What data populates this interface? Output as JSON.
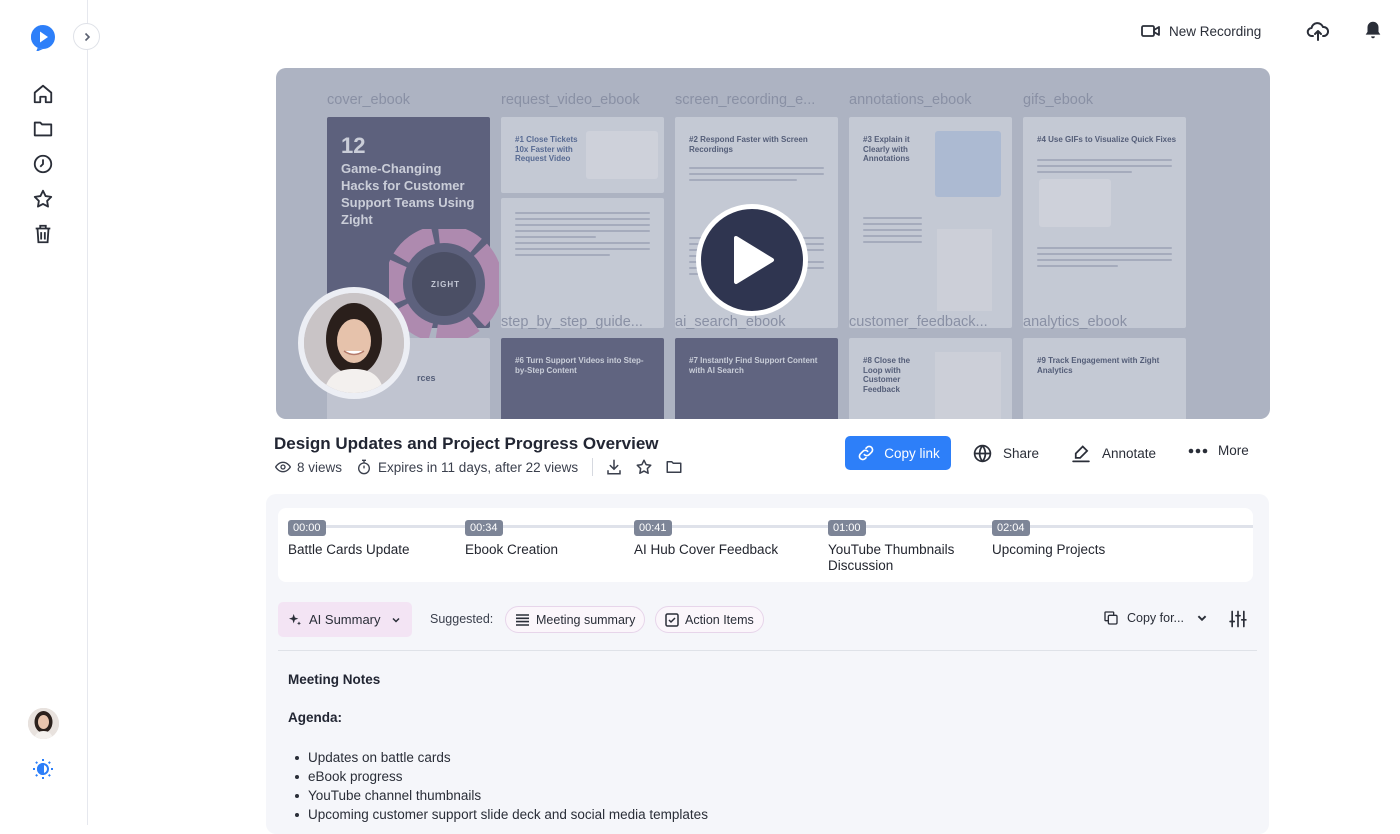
{
  "topbar": {
    "new_recording": "New Recording"
  },
  "video": {
    "thumbnails": [
      {
        "label": "cover_ebook"
      },
      {
        "label": "request_video_ebook"
      },
      {
        "label": "screen_recording_e..."
      },
      {
        "label": "annotations_ebook"
      },
      {
        "label": "gifs_ebook"
      },
      {
        "label": "step_by_step_guide..."
      },
      {
        "label": "ai_search_ebook"
      },
      {
        "label": "customer_feedback..."
      },
      {
        "label": "analytics_ebook"
      }
    ],
    "cover_number": "12",
    "cover_text": "Game-Changing Hacks for Customer Support Teams Using Zight",
    "cover_brand": "ZIGHT",
    "cover_partial": "rces",
    "cards": {
      "c1": "#1 Close Tickets 10x Faster with Request Video",
      "c2": "#2 Respond Faster with Screen Recordings",
      "c3": "#3 Explain it Clearly with Annotations",
      "c4": "#4 Use GIFs to Visualize Quick Fixes",
      "c6": "#6 Turn Support Videos into Step-by-Step Content",
      "c7": "#7 Instantly Find Support Content with AI Search",
      "c8": "#8 Close the Loop with Customer Feedback",
      "c9": "#9 Track Engagement with Zight Analytics"
    }
  },
  "recording": {
    "title": "Design Updates and Project Progress Overview",
    "views": "8 views",
    "expires": "Expires in 11 days, after 22 views"
  },
  "actions": {
    "copy_link": "Copy link",
    "share": "Share",
    "annotate": "Annotate",
    "more": "More"
  },
  "chapters": [
    {
      "time": "00:00",
      "name": "Battle Cards Update"
    },
    {
      "time": "00:34",
      "name": "Ebook Creation"
    },
    {
      "time": "00:41",
      "name": "AI Hub Cover Feedback"
    },
    {
      "time": "01:00",
      "name": "YouTube Thumbnails Discussion"
    },
    {
      "time": "02:04",
      "name": "Upcoming Projects"
    }
  ],
  "summary": {
    "ai_summary": "AI Summary",
    "suggested": "Suggested:",
    "meeting_summary": "Meeting summary",
    "action_items": "Action Items",
    "copy_for": "Copy for..."
  },
  "notes": {
    "heading": "Meeting Notes",
    "agenda_heading": "Agenda:",
    "agenda": [
      "Updates on battle cards",
      "eBook progress",
      "YouTube channel thumbnails",
      "Upcoming customer support slide deck and social media templates"
    ]
  },
  "colors": {
    "accent": "#2d7ff9",
    "ai_chip": "#f3e4f4",
    "chapter_badge": "#7d8597"
  }
}
